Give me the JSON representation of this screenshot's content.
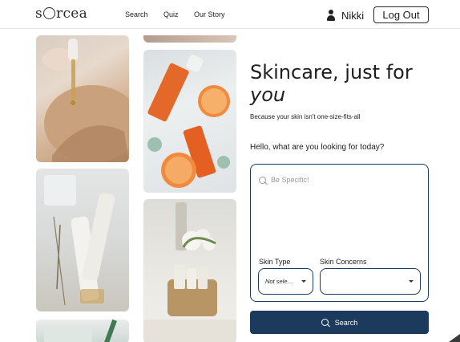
{
  "nav": {
    "logo": "s①rcea",
    "links": [
      "Search",
      "Quiz",
      "Our Story"
    ],
    "user_name": "Nikki",
    "logout_label": "Log Out"
  },
  "hero": {
    "title_line1": "Skincare, just for",
    "title_line2": "you",
    "subtitle": "Because your skin isn't one-size-fits-all",
    "question": "Hello, what are you looking for today?"
  },
  "search": {
    "placeholder": "Be Specific!",
    "skin_type_label": "Skin Type",
    "skin_type_value": "Not sele…",
    "skin_concerns_label": "Skin Concerns",
    "skin_concerns_value": "",
    "button_label": "Search"
  },
  "icons": {
    "user": "user-icon",
    "search": "search-icon",
    "dropdown": "chevron-down-icon"
  },
  "colors": {
    "accent": "#1c3a5c",
    "border": "#1d3a5f"
  }
}
